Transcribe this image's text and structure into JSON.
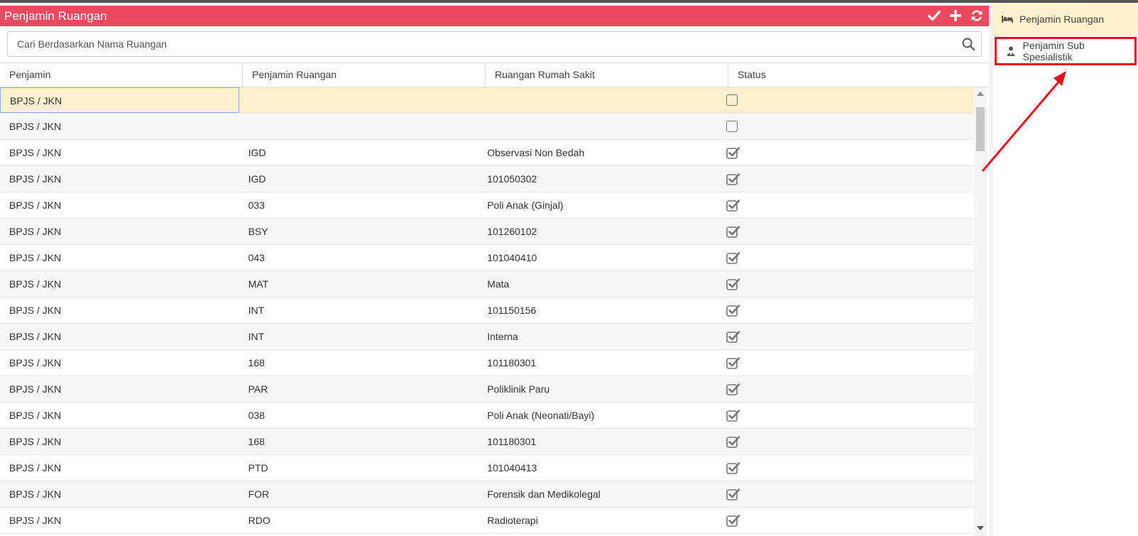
{
  "header": {
    "title": "Penjamin Ruangan",
    "actions": [
      {
        "name": "save",
        "icon": "check-icon"
      },
      {
        "name": "add",
        "icon": "plus-icon"
      },
      {
        "name": "refresh",
        "icon": "refresh-icon"
      }
    ]
  },
  "search": {
    "placeholder": "Cari Berdasarkan Nama Ruangan",
    "value": ""
  },
  "table": {
    "columns": [
      "Penjamin",
      "Penjamin Ruangan",
      "Ruangan Rumah Sakit",
      "Status"
    ],
    "rows": [
      {
        "penjamin": "BPJS / JKN",
        "penjamin_ruangan": "",
        "ruangan": "",
        "status": false
      },
      {
        "penjamin": "BPJS / JKN",
        "penjamin_ruangan": "",
        "ruangan": "",
        "status": false
      },
      {
        "penjamin": "BPJS / JKN",
        "penjamin_ruangan": "IGD",
        "ruangan": "Observasi Non Bedah",
        "status": true
      },
      {
        "penjamin": "BPJS / JKN",
        "penjamin_ruangan": "IGD",
        "ruangan": "101050302",
        "status": true
      },
      {
        "penjamin": "BPJS / JKN",
        "penjamin_ruangan": "033",
        "ruangan": "Poli Anak (Ginjal)",
        "status": true
      },
      {
        "penjamin": "BPJS / JKN",
        "penjamin_ruangan": "BSY",
        "ruangan": "101260102",
        "status": true
      },
      {
        "penjamin": "BPJS / JKN",
        "penjamin_ruangan": "043",
        "ruangan": "101040410",
        "status": true
      },
      {
        "penjamin": "BPJS / JKN",
        "penjamin_ruangan": "MAT",
        "ruangan": "Mata",
        "status": true
      },
      {
        "penjamin": "BPJS / JKN",
        "penjamin_ruangan": "INT",
        "ruangan": "101150156",
        "status": true
      },
      {
        "penjamin": "BPJS / JKN",
        "penjamin_ruangan": "INT",
        "ruangan": "Interna",
        "status": true
      },
      {
        "penjamin": "BPJS / JKN",
        "penjamin_ruangan": "168",
        "ruangan": "101180301",
        "status": true
      },
      {
        "penjamin": "BPJS / JKN",
        "penjamin_ruangan": "PAR",
        "ruangan": "Poliklinik Paru",
        "status": true
      },
      {
        "penjamin": "BPJS / JKN",
        "penjamin_ruangan": "038",
        "ruangan": "Poli Anak (Neonati/Bayi)",
        "status": true
      },
      {
        "penjamin": "BPJS / JKN",
        "penjamin_ruangan": "168",
        "ruangan": "101180301",
        "status": true
      },
      {
        "penjamin": "BPJS / JKN",
        "penjamin_ruangan": "PTD",
        "ruangan": "101040413",
        "status": true
      },
      {
        "penjamin": "BPJS / JKN",
        "penjamin_ruangan": "FOR",
        "ruangan": "Forensik dan Medikolegal",
        "status": true
      },
      {
        "penjamin": "BPJS / JKN",
        "penjamin_ruangan": "RDO",
        "ruangan": "Radioterapi",
        "status": true
      }
    ]
  },
  "sidebar": {
    "items": [
      {
        "label": "Penjamin Ruangan",
        "icon": "bed-icon",
        "active": true
      },
      {
        "label": "Penjamin Sub Spesialistik",
        "icon": "doctor-icon",
        "active": false,
        "highlighted": true
      }
    ]
  },
  "colors": {
    "header_bg": "#e84a5f",
    "selected_row_bg": "#fcf0cd",
    "highlight_box": "#e8101e"
  }
}
